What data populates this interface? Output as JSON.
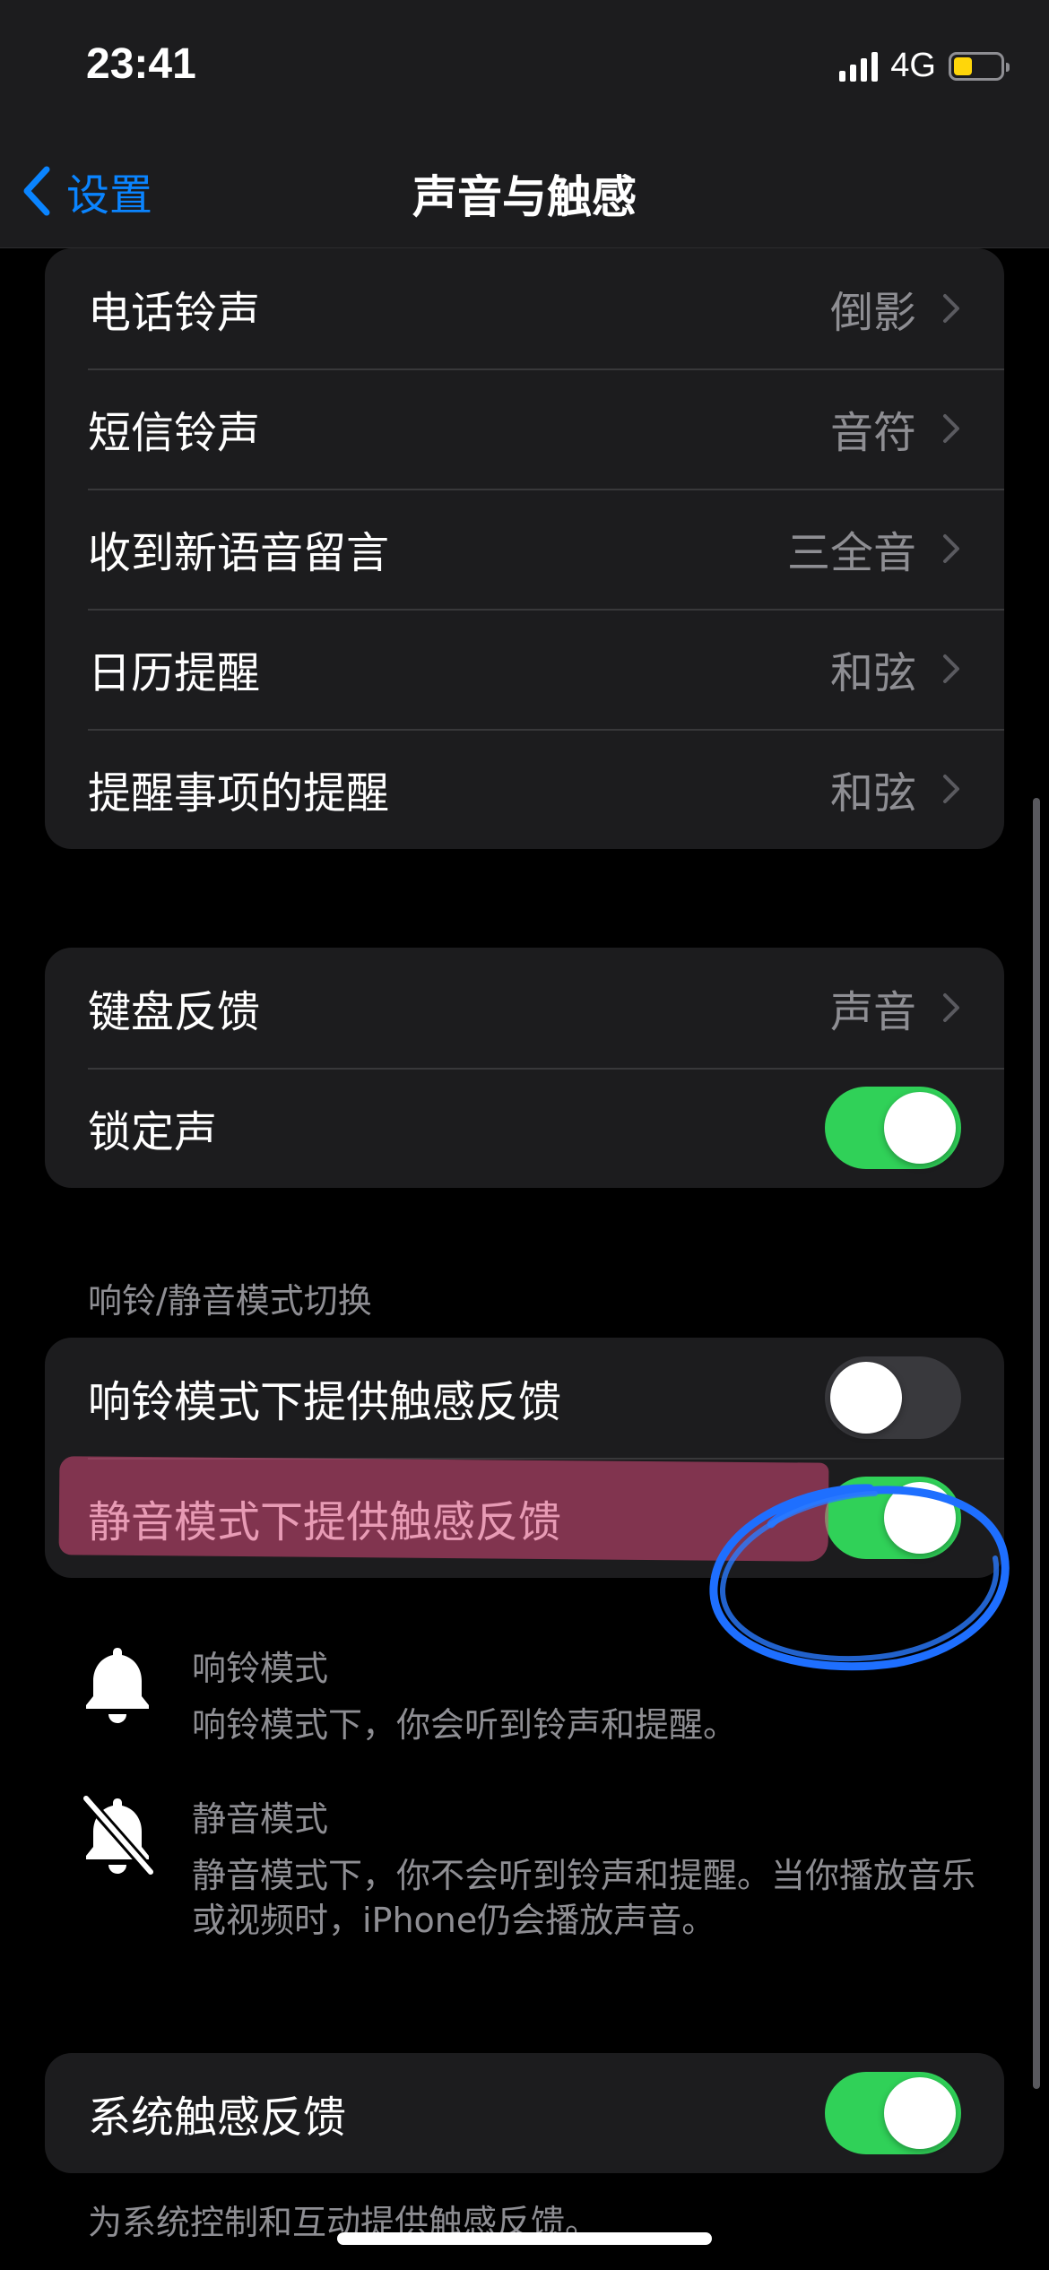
{
  "status_bar": {
    "time": "23:41",
    "network": "4G",
    "battery_level": 0.4,
    "battery_color": "#ffd60a"
  },
  "nav": {
    "back_label": "设置",
    "title": "声音与触感"
  },
  "ringtones": [
    {
      "label": "电话铃声",
      "value": "倒影"
    },
    {
      "label": "短信铃声",
      "value": "音符"
    },
    {
      "label": "收到新语音留言",
      "value": "三全音"
    },
    {
      "label": "日历提醒",
      "value": "和弦"
    },
    {
      "label": "提醒事项的提醒",
      "value": "和弦"
    }
  ],
  "feedback": {
    "keyboard": {
      "label": "键盘反馈",
      "value": "声音"
    },
    "lock": {
      "label": "锁定声",
      "on": true
    }
  },
  "ring_silent": {
    "header": "响铃/静音模式切换",
    "ring_haptic": {
      "label": "响铃模式下提供触感反馈",
      "on": false
    },
    "silent_haptic": {
      "label": "静音模式下提供触感反馈",
      "on": true
    }
  },
  "info": {
    "ring": {
      "title": "响铃模式",
      "desc": "响铃模式下，你会听到铃声和提醒。",
      "icon": "bell-icon"
    },
    "silent": {
      "title": "静音模式",
      "desc": "静音模式下，你不会听到铃声和提醒。当你播放音乐或视频时，iPhone仍会播放声音。",
      "icon": "bell-slash-icon"
    }
  },
  "system_haptics": {
    "label": "系统触感反馈",
    "on": true,
    "footer": "为系统控制和互动提供触感反馈。"
  },
  "colors": {
    "accent": "#0a84ff",
    "toggle_on": "#30d158",
    "highlight": "#d64878",
    "annotation_circle": "#1e6fff"
  }
}
